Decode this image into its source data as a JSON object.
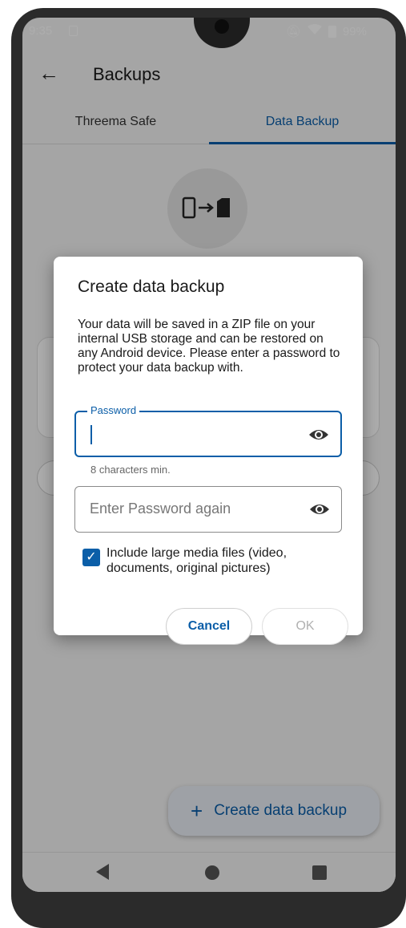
{
  "status_bar": {
    "time": "9:35",
    "battery": "99%"
  },
  "toolbar": {
    "title": "Backups"
  },
  "tabs": [
    {
      "label": "Threema Safe",
      "selected": false
    },
    {
      "label": "Data Backup",
      "selected": true
    }
  ],
  "fab": {
    "label": "Create data backup"
  },
  "dialog": {
    "title": "Create data backup",
    "message": "Your data will be saved in a ZIP file on your internal USB storage and can be restored on any Android device. Please enter a password to protect your data backup with.",
    "password_label": "Password",
    "password_value": "",
    "password_helper": "8 characters min.",
    "password_again_placeholder": "Enter Password again",
    "include_media_label": "Include large media files (video, documents, original pictures)",
    "include_media_checked": true,
    "cancel_label": "Cancel",
    "ok_label": "OK"
  },
  "colors": {
    "accent": "#0b5ea8",
    "scrim": "rgba(0,0,0,0.32)"
  },
  "icons": [
    "back-arrow-icon",
    "phone-to-sd-icon",
    "visibility-eye-icon",
    "check-icon",
    "plus-icon",
    "nav-back-icon",
    "nav-home-icon",
    "nav-recents-icon"
  ]
}
